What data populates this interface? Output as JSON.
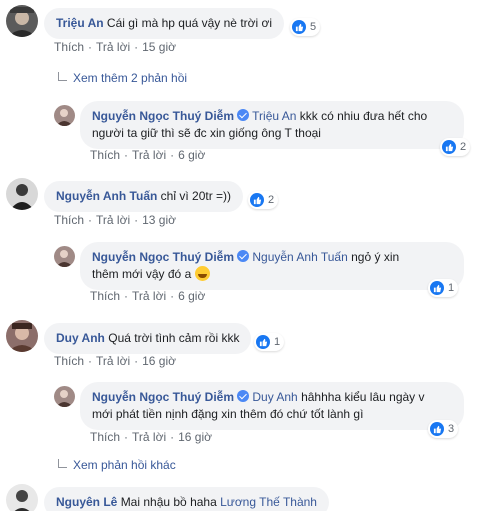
{
  "comments": [
    {
      "id": "c1",
      "author": "Triệu An",
      "text": "Cái gì mà hp quá vậy nè trời ơi",
      "likes": "5",
      "actions": {
        "like": "Thích",
        "reply": "Trả lời",
        "time": "15 giờ"
      },
      "view_more": "Xem thêm 2 phản hồi"
    },
    {
      "id": "r1",
      "author": "Nguyễn Ngọc Thuý Diễm",
      "mention": "Triệu An",
      "text_line1": "kkk có nhiu đưa hết cho",
      "text_line2": "người ta giữ thì sẽ đc xin giống ông T thoại",
      "likes": "2",
      "actions": {
        "like": "Thích",
        "reply": "Trả lời",
        "time": "6 giờ"
      }
    },
    {
      "id": "c2",
      "author": "Nguyễn Anh Tuấn",
      "text": "chỉ vì 20tr =))",
      "likes": "2",
      "actions": {
        "like": "Thích",
        "reply": "Trả lời",
        "time": "13 giờ"
      }
    },
    {
      "id": "r2",
      "author": "Nguyễn Ngọc Thuý Diễm",
      "mention": "Nguyễn Anh Tuấn",
      "text_line1": "ngỏ ý xin",
      "text_line2": "thêm mới vậy đó a",
      "likes": "1",
      "actions": {
        "like": "Thích",
        "reply": "Trả lời",
        "time": "6 giờ"
      }
    },
    {
      "id": "c3",
      "author": "Duy Anh",
      "text": "Quá trời tình cảm rồi kkk",
      "likes": "1",
      "actions": {
        "like": "Thích",
        "reply": "Trả lời",
        "time": "16 giờ"
      }
    },
    {
      "id": "r3",
      "author": "Nguyễn Ngọc Thuý Diễm",
      "mention": "Duy Anh",
      "text_line1": "hâhhha kiểu lâu ngày v",
      "text_line2": "mới phát tiền nịnh đặng xin thêm đó chứ tốt lành gì",
      "likes": "3",
      "actions": {
        "like": "Thích",
        "reply": "Trả lời",
        "time": "16 giờ"
      },
      "view_more": "Xem phản hồi khác"
    },
    {
      "id": "c4",
      "author": "Nguyên Lê",
      "text": "Mai nhậu bồ haha",
      "mention": "Lương Thế Thành"
    }
  ],
  "separator": "·",
  "colors": {
    "link": "#385898",
    "bubble": "#f2f3f5",
    "like_blue": "#1877f2",
    "meta": "#606770"
  },
  "icons": {
    "like": "thumbs-up-icon",
    "verified": "verified-badge-icon",
    "emoji": "grinning-face-icon",
    "reply_arrow": "reply-arrow-icon"
  }
}
